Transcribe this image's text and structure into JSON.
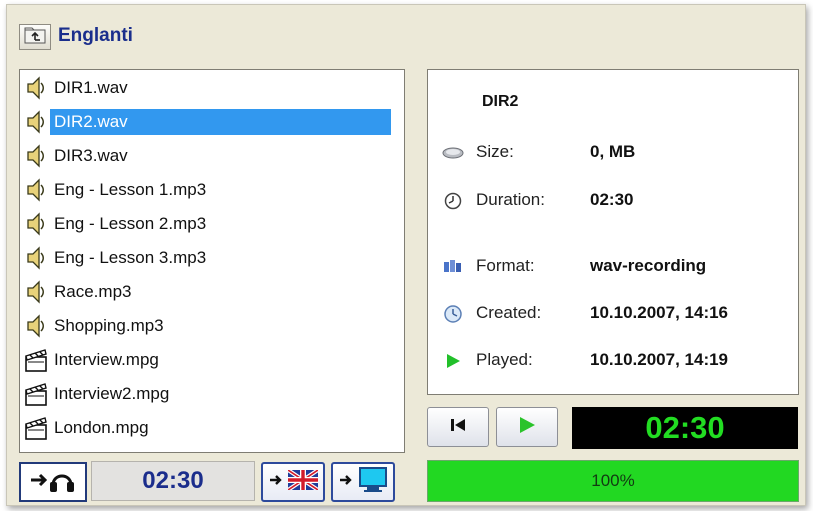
{
  "header": {
    "title": "Englanti",
    "up_icon": "folder-up-icon"
  },
  "file_list": [
    {
      "name": "DIR1.wav",
      "type": "audio",
      "icon": "speaker-icon",
      "selected": false
    },
    {
      "name": "DIR2.wav",
      "type": "audio",
      "icon": "speaker-icon",
      "selected": true
    },
    {
      "name": "DIR3.wav",
      "type": "audio",
      "icon": "speaker-icon",
      "selected": false
    },
    {
      "name": "Eng - Lesson 1.mp3",
      "type": "audio",
      "icon": "speaker-icon",
      "selected": false
    },
    {
      "name": "Eng - Lesson 2.mp3",
      "type": "audio",
      "icon": "speaker-icon",
      "selected": false
    },
    {
      "name": "Eng - Lesson 3.mp3",
      "type": "audio",
      "icon": "speaker-icon",
      "selected": false
    },
    {
      "name": "Race.mp3",
      "type": "audio",
      "icon": "speaker-icon",
      "selected": false
    },
    {
      "name": "Shopping.mp3",
      "type": "audio",
      "icon": "speaker-icon",
      "selected": false
    },
    {
      "name": "Interview.mpg",
      "type": "video",
      "icon": "clapperboard-icon",
      "selected": false
    },
    {
      "name": "Interview2.mpg",
      "type": "video",
      "icon": "clapperboard-icon",
      "selected": false
    },
    {
      "name": "London.mpg",
      "type": "video",
      "icon": "clapperboard-icon",
      "selected": false
    }
  ],
  "info": {
    "name": "DIR2",
    "rows": [
      {
        "key": "size",
        "icon": "disk-icon",
        "label": "Size:",
        "value": "0, MB"
      },
      {
        "key": "duration",
        "icon": "clock-icon",
        "label": "Duration:",
        "value": "02:30"
      },
      {
        "key": "format",
        "icon": "format-icon",
        "label": "Format:",
        "value": "wav-recording"
      },
      {
        "key": "created",
        "icon": "created-icon",
        "label": "Created:",
        "value": "10.10.2007, 14:16"
      },
      {
        "key": "played",
        "icon": "play-triangle-icon",
        "label": "Played:",
        "value": "10.10.2007, 14:19"
      }
    ]
  },
  "player": {
    "rewind_icon": "skip-to-start-icon",
    "play_icon": "play-icon",
    "time": "02:30"
  },
  "progress": {
    "label": "100%",
    "value": 1.0
  },
  "bottom_left": {
    "time": "02:30",
    "headphone_icon": "headphones-icon",
    "translate_icon": "uk-flag-icon",
    "screen_icon": "monitor-icon"
  },
  "colors": {
    "selection": "#3298ef",
    "title": "#1a2e8c",
    "time_display_bg": "#000000",
    "time_display_fg": "#22dd22",
    "progress": "#1fd51f",
    "window_bg": "#ece9d8"
  }
}
